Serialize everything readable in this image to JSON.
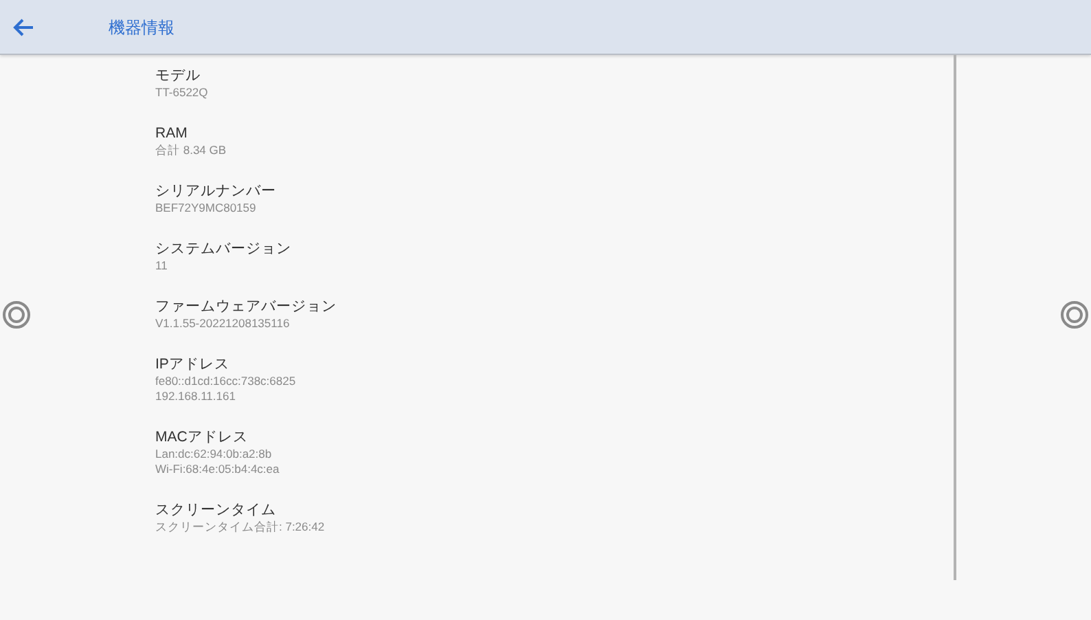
{
  "header": {
    "title": "機器情報"
  },
  "items": [
    {
      "title": "モデル",
      "values": [
        "TT-6522Q"
      ]
    },
    {
      "title": "RAM",
      "values": [
        "合計 8.34 GB"
      ]
    },
    {
      "title": "シリアルナンバー",
      "values": [
        "BEF72Y9MC80159"
      ]
    },
    {
      "title": "システムバージョン",
      "values": [
        "11"
      ]
    },
    {
      "title": "ファームウェアバージョン",
      "values": [
        "V1.1.55-20221208135116"
      ]
    },
    {
      "title": "IPアドレス",
      "values": [
        "fe80::d1cd:16cc:738c:6825",
        "192.168.11.161"
      ]
    },
    {
      "title": "MACアドレス",
      "values": [
        "Lan:dc:62:94:0b:a2:8b",
        "Wi-Fi:68:4e:05:b4:4c:ea"
      ]
    },
    {
      "title": "スクリーンタイム",
      "values": [
        "スクリーンタイム合計: 7:26:42"
      ]
    }
  ]
}
